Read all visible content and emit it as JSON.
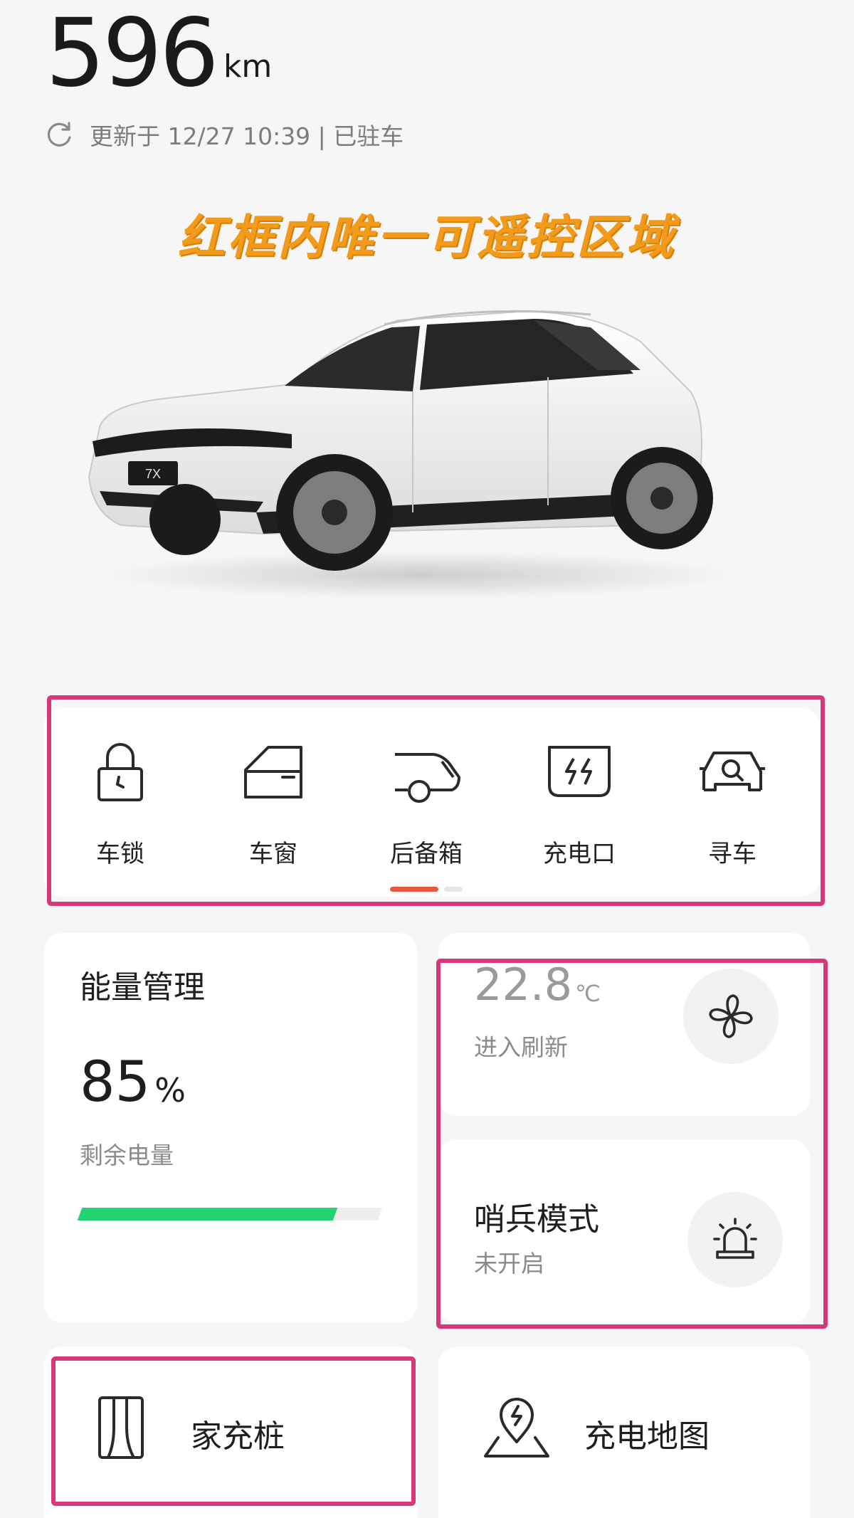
{
  "range": {
    "value": "596",
    "unit": "km"
  },
  "status": {
    "text": "更新于 12/27 10:39 | 已驻车"
  },
  "banner": {
    "text": "红框内唯一可遥控区域"
  },
  "car": {
    "plate": "7X"
  },
  "controls": [
    {
      "label": "车锁",
      "icon": "lock-icon"
    },
    {
      "label": "车窗",
      "icon": "car-window-icon"
    },
    {
      "label": "后备箱",
      "icon": "trunk-icon"
    },
    {
      "label": "充电口",
      "icon": "charging-port-icon"
    },
    {
      "label": "寻车",
      "icon": "find-car-icon"
    }
  ],
  "energy": {
    "title": "能量管理",
    "value": "85",
    "unit": "%",
    "label": "剩余电量",
    "battery_fraction": 0.85,
    "bar_color": "#22d36f"
  },
  "climate": {
    "temperature": "22.8",
    "unit": "℃",
    "label": "进入刷新",
    "icon": "fan-icon"
  },
  "sentry": {
    "title": "哨兵模式",
    "status": "未开启",
    "icon": "alarm-light-icon"
  },
  "home_charger": {
    "label": "家充桩",
    "icon": "charger-pile-icon"
  },
  "charge_map": {
    "label": "充电地图",
    "icon": "map-pin-charge-icon"
  },
  "colors": {
    "highlight": "#d8377b",
    "banner": "#f29a19",
    "accent_dot": "#e85940"
  }
}
